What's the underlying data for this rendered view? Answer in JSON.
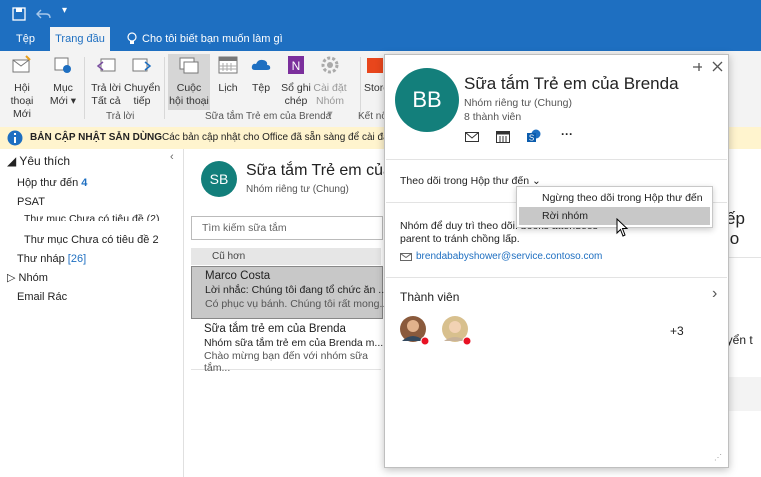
{
  "ribbon_tabs": [
    "Tệp",
    "Trang đầu"
  ],
  "tell_me": "Cho tôi biết bạn muốn làm gì",
  "ribbon": {
    "new_meeting": [
      "Hội thoại",
      "Mới"
    ],
    "items": [
      "Mục",
      "Mới ▾"
    ],
    "reply_all": [
      "Trả lời",
      "Tất cả"
    ],
    "forward": [
      "Chuyển",
      "tiếp"
    ],
    "conversations": [
      "Cuộc",
      "hội thoại"
    ],
    "calendar": "Lịch",
    "files": "Tệp",
    "notebook": [
      "Sổ ghi",
      "chép"
    ],
    "settings": [
      "Cài đặt",
      "Nhóm ▾"
    ],
    "store": "Store",
    "group_reply": "Trả lời",
    "group_group": "Sữa tắm Trẻ em của Brenda",
    "group_connect": "Kết nối"
  },
  "infobar": {
    "title": "BẢN CẬP NHẬT SẴN DÙNG",
    "text": "Các bản cập nhật cho Office đã sẵn sàng để cài đặt nh"
  },
  "nav": {
    "favorites": "Yêu thích",
    "inbox": "Hộp thư đến",
    "inbox_count": "4",
    "psat": "PSAT",
    "uncat1": "Thư mục Chưa có tiêu đề (2)",
    "uncat2": "Thư mục Chưa có tiêu đề 2",
    "drafts": "Thư nháp",
    "drafts_count": "[26]",
    "groups": "Nhóm",
    "junk": "Email Rác"
  },
  "middle": {
    "avatar": "SB",
    "group_title": "Sữa tắm Trẻ em của",
    "group_sub": "Nhóm riêng tư (Chung)",
    "search_placeholder": "Tìm kiếm sữa tắm",
    "sort_label": "Cũ hơn",
    "messages": [
      {
        "sender": "Marco Costa",
        "subject": "Lời nhắc: Chúng tôi đang tổ chức ăn ...",
        "preview": "Có phục vụ bánh. Chúng tôi rất mong..."
      },
      {
        "sender": "Sữa tắm trẻ em của Brenda",
        "subject": "Nhóm sữa tắm trẻ em của Brenda m...",
        "preview": "Chào mừng bạn đến với nhóm sữa tắm..."
      }
    ]
  },
  "right": {
    "t1": "ếp lo",
    "t2": "uyển t"
  },
  "card": {
    "avatar": "BB",
    "title": "Sữa tắm Trẻ em của Brenda",
    "subtitle": "Nhóm riêng tư (Chung)",
    "members_count": "8 thành viên",
    "follow_label": "Theo dõi trong Hộp thư đến",
    "description": "Nhóm để duy trì theo dõi. books attendees parent to tránh chồng lấp.",
    "email": "brendababyshower@service.contoso.com",
    "members_label": "Thành viên",
    "more_members": "+3"
  },
  "menu": {
    "stop_follow": "Ngừng theo dõi trong Hộp thư đến",
    "leave_group": "Rời nhóm"
  },
  "colors": {
    "accent": "#1e6fc1",
    "avatar": "#137f7b",
    "infobar": "#fff4ce"
  }
}
